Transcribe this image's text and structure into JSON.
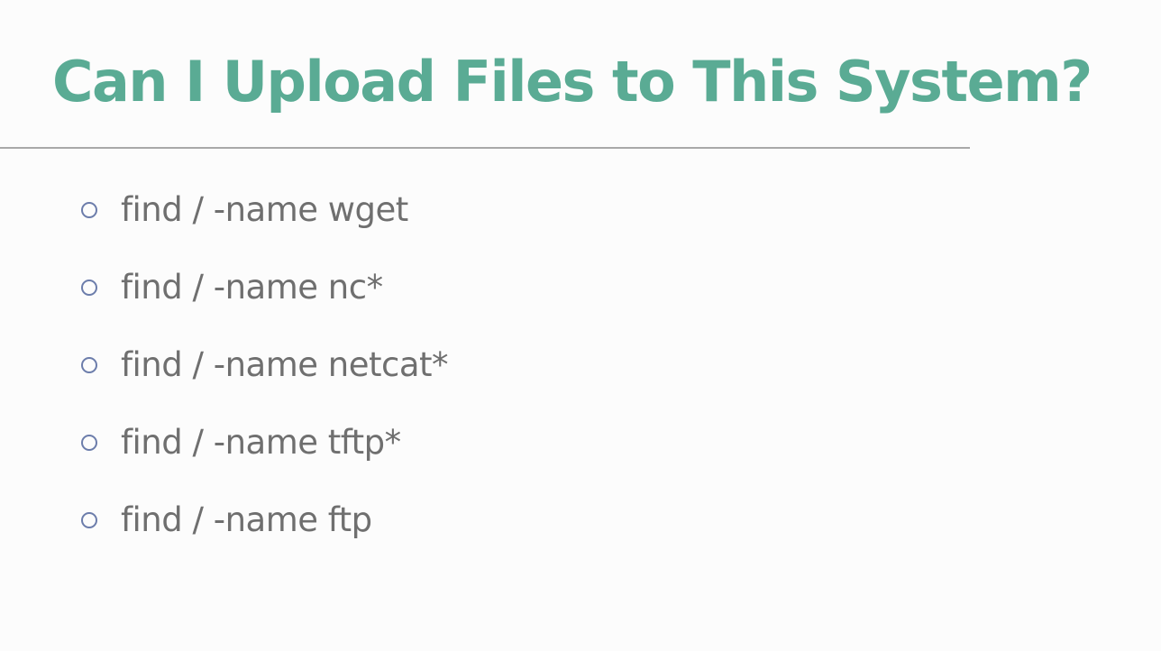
{
  "slide": {
    "title": "Can I Upload Files to This System?",
    "bullets": [
      {
        "text": "find / -name wget",
        "marker": "hollow-circle"
      },
      {
        "text": "find / -name nc*",
        "marker": "hollow-circle"
      },
      {
        "text": "find / -name netcat*",
        "marker": "hollow-circle"
      },
      {
        "text": "find / -name tftp*",
        "marker": "hollow-circle"
      },
      {
        "text": "find / -name ftp",
        "marker": "hollow-circle"
      }
    ]
  },
  "colors": {
    "title": "#5aab94",
    "rule": "#a9a9a9",
    "bullet_marker": "#6c7dab",
    "bullet_text": "#6f6f6f",
    "background": "#fcfcfc"
  }
}
